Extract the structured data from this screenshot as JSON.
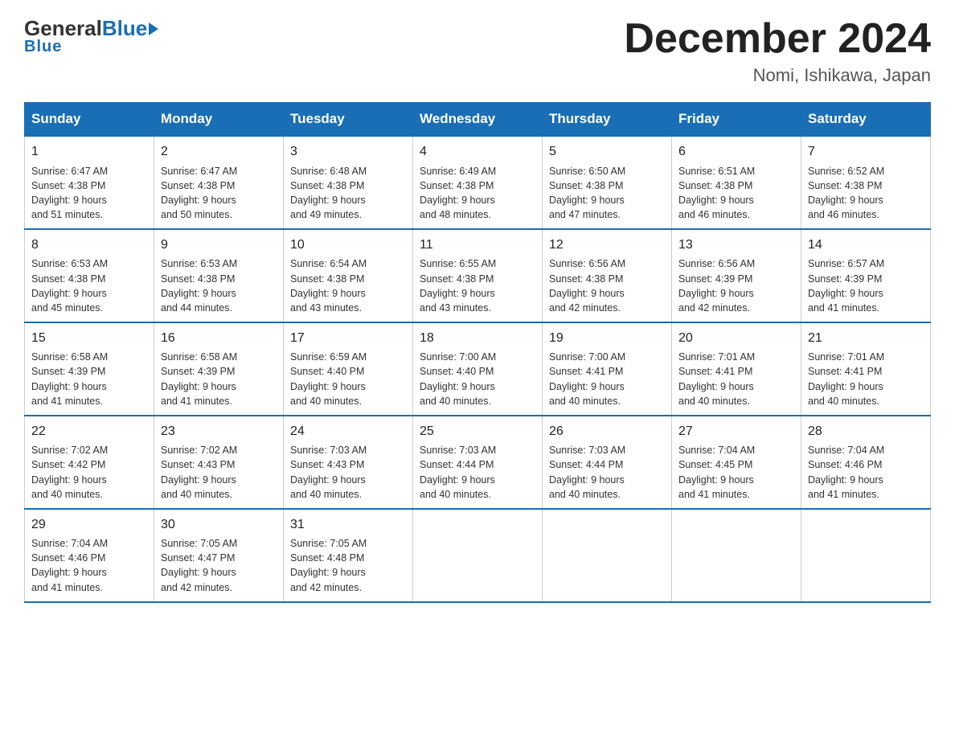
{
  "logo": {
    "general": "General",
    "blue": "Blue"
  },
  "header": {
    "title": "December 2024",
    "location": "Nomi, Ishikawa, Japan"
  },
  "weekdays": [
    "Sunday",
    "Monday",
    "Tuesday",
    "Wednesday",
    "Thursday",
    "Friday",
    "Saturday"
  ],
  "weeks": [
    [
      {
        "day": "1",
        "sunrise": "6:47 AM",
        "sunset": "4:38 PM",
        "daylight": "9 hours and 51 minutes."
      },
      {
        "day": "2",
        "sunrise": "6:47 AM",
        "sunset": "4:38 PM",
        "daylight": "9 hours and 50 minutes."
      },
      {
        "day": "3",
        "sunrise": "6:48 AM",
        "sunset": "4:38 PM",
        "daylight": "9 hours and 49 minutes."
      },
      {
        "day": "4",
        "sunrise": "6:49 AM",
        "sunset": "4:38 PM",
        "daylight": "9 hours and 48 minutes."
      },
      {
        "day": "5",
        "sunrise": "6:50 AM",
        "sunset": "4:38 PM",
        "daylight": "9 hours and 47 minutes."
      },
      {
        "day": "6",
        "sunrise": "6:51 AM",
        "sunset": "4:38 PM",
        "daylight": "9 hours and 46 minutes."
      },
      {
        "day": "7",
        "sunrise": "6:52 AM",
        "sunset": "4:38 PM",
        "daylight": "9 hours and 46 minutes."
      }
    ],
    [
      {
        "day": "8",
        "sunrise": "6:53 AM",
        "sunset": "4:38 PM",
        "daylight": "9 hours and 45 minutes."
      },
      {
        "day": "9",
        "sunrise": "6:53 AM",
        "sunset": "4:38 PM",
        "daylight": "9 hours and 44 minutes."
      },
      {
        "day": "10",
        "sunrise": "6:54 AM",
        "sunset": "4:38 PM",
        "daylight": "9 hours and 43 minutes."
      },
      {
        "day": "11",
        "sunrise": "6:55 AM",
        "sunset": "4:38 PM",
        "daylight": "9 hours and 43 minutes."
      },
      {
        "day": "12",
        "sunrise": "6:56 AM",
        "sunset": "4:38 PM",
        "daylight": "9 hours and 42 minutes."
      },
      {
        "day": "13",
        "sunrise": "6:56 AM",
        "sunset": "4:39 PM",
        "daylight": "9 hours and 42 minutes."
      },
      {
        "day": "14",
        "sunrise": "6:57 AM",
        "sunset": "4:39 PM",
        "daylight": "9 hours and 41 minutes."
      }
    ],
    [
      {
        "day": "15",
        "sunrise": "6:58 AM",
        "sunset": "4:39 PM",
        "daylight": "9 hours and 41 minutes."
      },
      {
        "day": "16",
        "sunrise": "6:58 AM",
        "sunset": "4:39 PM",
        "daylight": "9 hours and 41 minutes."
      },
      {
        "day": "17",
        "sunrise": "6:59 AM",
        "sunset": "4:40 PM",
        "daylight": "9 hours and 40 minutes."
      },
      {
        "day": "18",
        "sunrise": "7:00 AM",
        "sunset": "4:40 PM",
        "daylight": "9 hours and 40 minutes."
      },
      {
        "day": "19",
        "sunrise": "7:00 AM",
        "sunset": "4:41 PM",
        "daylight": "9 hours and 40 minutes."
      },
      {
        "day": "20",
        "sunrise": "7:01 AM",
        "sunset": "4:41 PM",
        "daylight": "9 hours and 40 minutes."
      },
      {
        "day": "21",
        "sunrise": "7:01 AM",
        "sunset": "4:41 PM",
        "daylight": "9 hours and 40 minutes."
      }
    ],
    [
      {
        "day": "22",
        "sunrise": "7:02 AM",
        "sunset": "4:42 PM",
        "daylight": "9 hours and 40 minutes."
      },
      {
        "day": "23",
        "sunrise": "7:02 AM",
        "sunset": "4:43 PM",
        "daylight": "9 hours and 40 minutes."
      },
      {
        "day": "24",
        "sunrise": "7:03 AM",
        "sunset": "4:43 PM",
        "daylight": "9 hours and 40 minutes."
      },
      {
        "day": "25",
        "sunrise": "7:03 AM",
        "sunset": "4:44 PM",
        "daylight": "9 hours and 40 minutes."
      },
      {
        "day": "26",
        "sunrise": "7:03 AM",
        "sunset": "4:44 PM",
        "daylight": "9 hours and 40 minutes."
      },
      {
        "day": "27",
        "sunrise": "7:04 AM",
        "sunset": "4:45 PM",
        "daylight": "9 hours and 41 minutes."
      },
      {
        "day": "28",
        "sunrise": "7:04 AM",
        "sunset": "4:46 PM",
        "daylight": "9 hours and 41 minutes."
      }
    ],
    [
      {
        "day": "29",
        "sunrise": "7:04 AM",
        "sunset": "4:46 PM",
        "daylight": "9 hours and 41 minutes."
      },
      {
        "day": "30",
        "sunrise": "7:05 AM",
        "sunset": "4:47 PM",
        "daylight": "9 hours and 42 minutes."
      },
      {
        "day": "31",
        "sunrise": "7:05 AM",
        "sunset": "4:48 PM",
        "daylight": "9 hours and 42 minutes."
      },
      null,
      null,
      null,
      null
    ]
  ],
  "labels": {
    "sunrise": "Sunrise: ",
    "sunset": "Sunset: ",
    "daylight": "Daylight: "
  }
}
